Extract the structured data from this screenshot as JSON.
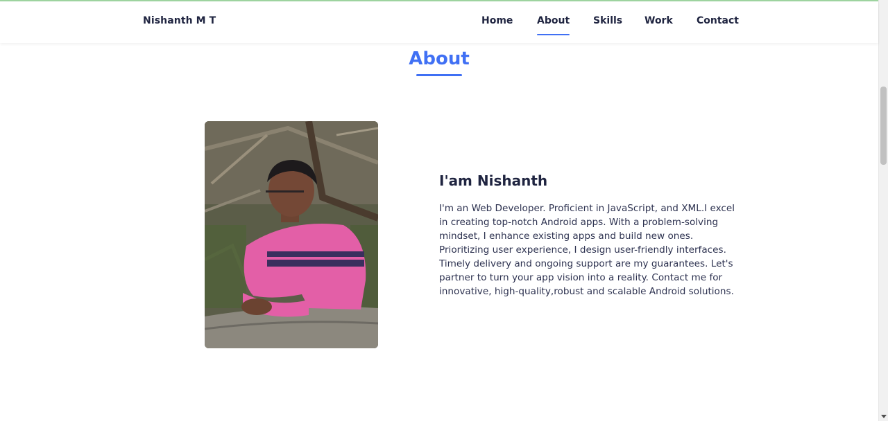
{
  "header": {
    "brand": "Nishanth M T",
    "nav": [
      {
        "label": "Home",
        "active": false
      },
      {
        "label": "About",
        "active": true
      },
      {
        "label": "Skills",
        "active": false
      },
      {
        "label": "Work",
        "active": false
      },
      {
        "label": "Contact",
        "active": false
      }
    ]
  },
  "about": {
    "title": "About",
    "name": "I'am Nishanth",
    "description": "I'm an Web Developer. Proficient in JavaScript, and XML.I excel in creating top-notch Android apps. With a problem-solving mindset, I enhance existing apps and build new ones. Prioritizing user experience, I design user-friendly interfaces. Timely delivery and ongoing support are my guarantees. Let's partner to turn your app vision into a reality. Contact me for innovative, high-quality,robust and scalable Android solutions."
  },
  "colors": {
    "accent": "#4070f4",
    "text": "#1f2440"
  }
}
